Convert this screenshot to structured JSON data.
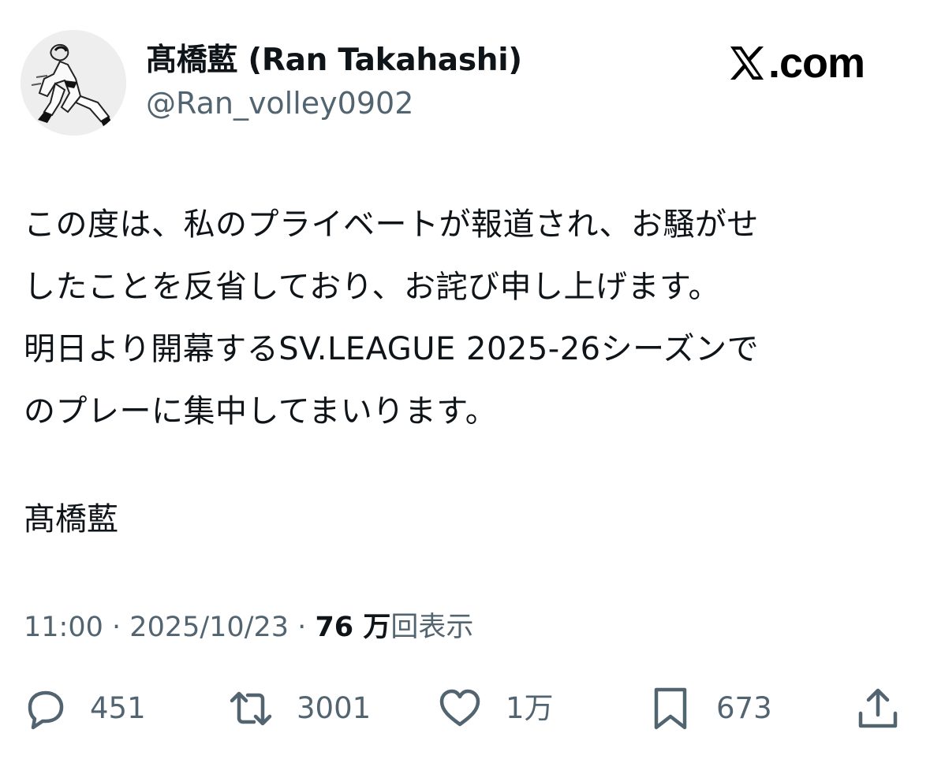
{
  "author": {
    "display_name": "髙橋藍 (Ran Takahashi)",
    "handle": "@Ran_volley0902",
    "avatar_icon": "avatar-illustration-volleyball-player"
  },
  "brand": {
    "logo_icon": "x-logo-icon",
    "text": ".com"
  },
  "post": {
    "lines": [
      "この度は、私のプライベートが報道され、お騒がせ",
      "したことを反省しており、お詫び申し上げます。",
      "明日より開幕するSV.LEAGUE 2025-26シーズンで",
      "のプレーに集中してまいります。"
    ],
    "signature": "髙橋藍"
  },
  "meta": {
    "time": "11:00",
    "sep1": "·",
    "date": "2025/10/23",
    "sep2": "·",
    "views_count": "76 万",
    "views_label": "回表示"
  },
  "actions": {
    "reply": {
      "icon": "reply-icon",
      "count": "451"
    },
    "repost": {
      "icon": "repost-icon",
      "count": "3001"
    },
    "like": {
      "icon": "heart-icon",
      "count": "1万"
    },
    "bookmark": {
      "icon": "bookmark-icon",
      "count": "673"
    },
    "share": {
      "icon": "share-icon"
    }
  },
  "colors": {
    "text_primary": "#0f1419",
    "text_secondary": "#536471",
    "background": "#ffffff"
  }
}
